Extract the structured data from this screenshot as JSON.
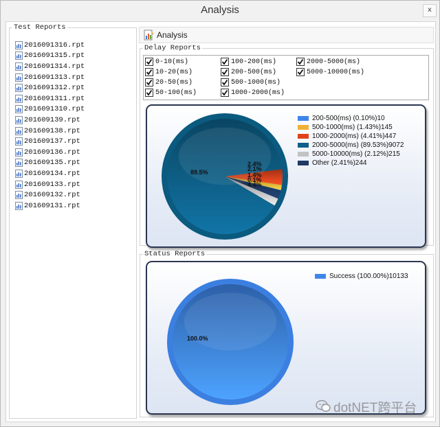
{
  "window": {
    "title": "Analysis",
    "close_label": "x"
  },
  "test_reports": {
    "legend": "Test Reports",
    "files": [
      "2016091316.rpt",
      "2016091315.rpt",
      "2016091314.rpt",
      "2016091313.rpt",
      "2016091312.rpt",
      "2016091311.rpt",
      "2016091310.rpt",
      "201609139.rpt",
      "201609138.rpt",
      "201609137.rpt",
      "201609136.rpt",
      "201609135.rpt",
      "201609134.rpt",
      "201609133.rpt",
      "201609132.rpt",
      "201609131.rpt"
    ]
  },
  "toolbar": {
    "analysis_label": "Analysis"
  },
  "delay_reports": {
    "legend": "Delay  Reports",
    "checkboxes": [
      {
        "label": "0-10(ms)",
        "checked": true
      },
      {
        "label": "100-200(ms)",
        "checked": true
      },
      {
        "label": "2000-5000(ms)",
        "checked": true
      },
      {
        "label": "10-20(ms)",
        "checked": true
      },
      {
        "label": "200-500(ms)",
        "checked": true
      },
      {
        "label": "5000-10000(ms)",
        "checked": true
      },
      {
        "label": "20-50(ms)",
        "checked": true
      },
      {
        "label": "500-1000(ms)",
        "checked": true
      },
      {
        "label": "50-100(ms)",
        "checked": true
      },
      {
        "label": "1000-2000(ms)",
        "checked": true
      }
    ]
  },
  "status_reports": {
    "legend": "Status Reports"
  },
  "watermark": {
    "text": "dotNET跨平台"
  },
  "chart_data": [
    {
      "type": "pie",
      "colors": [
        "#3f86ea",
        "#f1b138",
        "#e0421c",
        "#0e6088",
        "#c3c3c3",
        "#1e3963"
      ],
      "slices": [
        {
          "name": "200-500(ms)",
          "percent": 0.1,
          "count": 10,
          "legend": "200-500(ms) (0.10%)10",
          "label": "0.1%"
        },
        {
          "name": "500-1000(ms)",
          "percent": 1.43,
          "count": 145,
          "legend": "500-1000(ms) (1.43%)145",
          "label": "1.4%"
        },
        {
          "name": "1000-2000(ms)",
          "percent": 4.41,
          "count": 447,
          "legend": "1000-2000(ms) (4.41%)447",
          "label": "4.4%"
        },
        {
          "name": "2000-5000(ms)",
          "percent": 89.53,
          "count": 9072,
          "legend": "2000-5000(ms) (89.53%)9072",
          "label": "89.5%"
        },
        {
          "name": "5000-10000(ms)",
          "percent": 2.12,
          "count": 215,
          "legend": "5000-10000(ms) (2.12%)215",
          "label": "2.1%"
        },
        {
          "name": "Other",
          "percent": 2.41,
          "count": 244,
          "legend": "Other (2.41%)244",
          "label": "2.4%"
        }
      ]
    },
    {
      "type": "pie",
      "colors": [
        "#3f86ea"
      ],
      "slices": [
        {
          "name": "Success",
          "percent": 100.0,
          "count": 10133,
          "legend": "Success (100.00%)10133",
          "label": "100.0%"
        }
      ]
    }
  ]
}
